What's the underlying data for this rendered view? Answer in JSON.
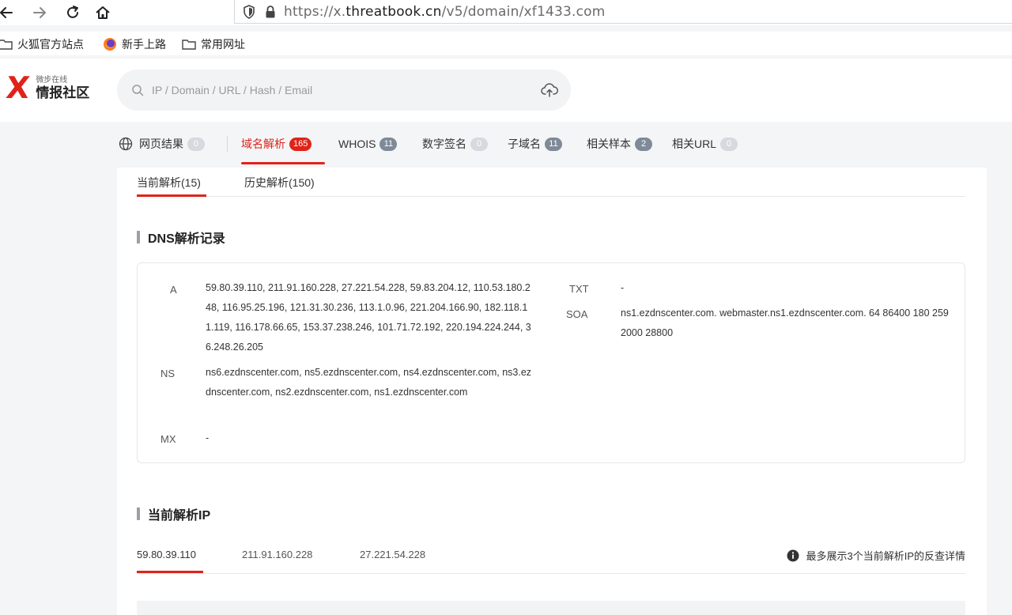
{
  "browser": {
    "url_prefix": "https://x.",
    "url_domain": "threatbook.cn",
    "url_path": "/v5/domain/xf1433.com",
    "bookmarks": [
      {
        "label": "火狐官方站点"
      },
      {
        "label": "新手上路"
      },
      {
        "label": "常用网址"
      }
    ]
  },
  "site": {
    "logo_mark": "X",
    "logo_small": "微步在线",
    "logo_big": "情报社区",
    "search_placeholder": "IP / Domain / URL / Hash / Email"
  },
  "tabs": [
    {
      "label": "网页结果",
      "count": "0"
    },
    {
      "label": "域名解析",
      "count": "165"
    },
    {
      "label": "WHOIS",
      "count": "11"
    },
    {
      "label": "数字签名",
      "count": "0"
    },
    {
      "label": "子域名",
      "count": "11"
    },
    {
      "label": "相关样本",
      "count": "2"
    },
    {
      "label": "相关URL",
      "count": "0"
    }
  ],
  "subtabs": [
    {
      "label": "当前解析(15)"
    },
    {
      "label": "历史解析(150)"
    }
  ],
  "dns": {
    "title": "DNS解析记录",
    "records": {
      "a_key": "A",
      "a_val": "59.80.39.110, 211.91.160.228, 27.221.54.228, 59.83.204.12, 110.53.180.248, 116.95.25.196, 121.31.30.236, 113.1.0.96, 221.204.166.90, 182.118.11.119, 116.178.66.65, 153.37.238.246, 101.71.72.192, 220.194.224.244, 36.248.26.205",
      "ns_key": "NS",
      "ns_val": "ns6.ezdnscenter.com, ns5.ezdnscenter.com, ns4.ezdnscenter.com, ns3.ezdnscenter.com, ns2.ezdnscenter.com, ns1.ezdnscenter.com",
      "mx_key": "MX",
      "mx_val": "-",
      "txt_key": "TXT",
      "txt_val": "-",
      "soa_key": "SOA",
      "soa_val": "ns1.ezdnscenter.com. webmaster.ns1.ezdnscenter.com. 64 86400 180 2592000 28800"
    }
  },
  "current_ip": {
    "title": "当前解析IP",
    "ips": [
      "59.80.39.110",
      "211.91.160.228",
      "27.221.54.228"
    ],
    "note": "最多展示3个当前解析IP的反查详情"
  },
  "colors": {
    "accent": "#e0231a",
    "badge_gray": "#7f8a98"
  }
}
